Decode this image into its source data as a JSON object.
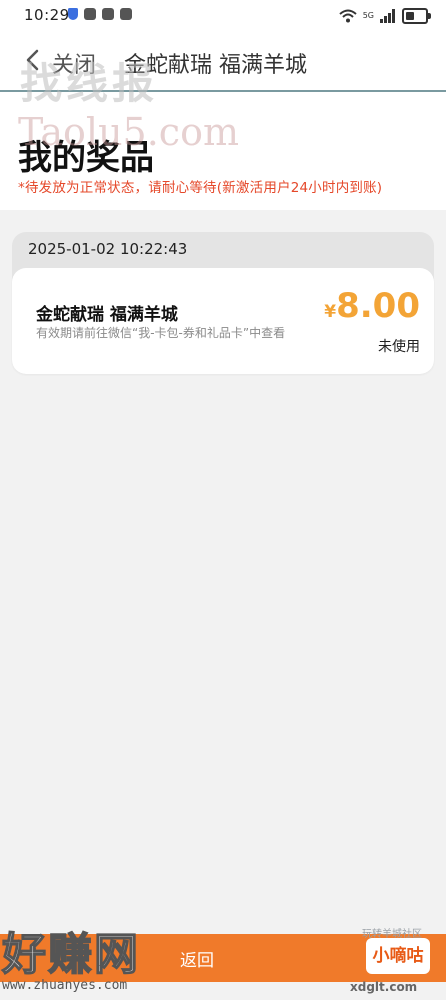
{
  "status_bar": {
    "time": "10:29",
    "network": "5G"
  },
  "nav": {
    "close_label": "关闭",
    "title": "金蛇献瑞 福满羊城"
  },
  "header": {
    "title": "我的奖品",
    "notice": "*待发放为正常状态，请耐心等待(新激活用户24小时内到账)"
  },
  "prize": {
    "date": "2025-01-02 10:22:43",
    "name": "金蛇献瑞 福满羊城",
    "desc": "有效期请前往微信“我-卡包-券和礼品卡”中查看",
    "currency": "¥",
    "amount": "8.00",
    "status": "未使用"
  },
  "bottom": {
    "back_label": "返回",
    "badge_label": "小嘀咕",
    "badge_caption": "玩转羊城社区"
  },
  "watermarks": {
    "top_cn": "找线报",
    "top_en": "Taolu5.com",
    "bottom_cn": "好赚网",
    "bottom_url": "www.zhuanyes.com",
    "corner": "xdglt.com"
  },
  "colors": {
    "accent_orange": "#f07a2a",
    "price": "#f3a436",
    "notice_red": "#e5482a"
  }
}
